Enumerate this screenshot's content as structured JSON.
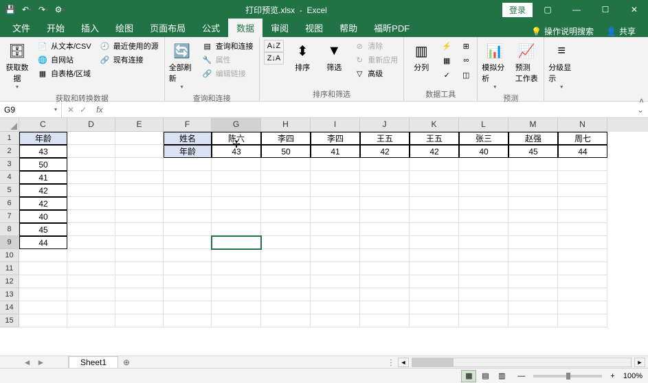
{
  "title": {
    "file": "打印预览.xlsx",
    "app": "Excel",
    "login": "登录"
  },
  "tabs": {
    "file": "文件",
    "home": "开始",
    "insert": "插入",
    "draw": "绘图",
    "layout": "页面布局",
    "formulas": "公式",
    "data": "数据",
    "review": "审阅",
    "view": "视图",
    "help": "帮助",
    "foxit": "福昕PDF",
    "tellme": "操作说明搜索",
    "share": "共享"
  },
  "ribbon": {
    "get_data": "获取数\n据",
    "from_csv": "从文本/CSV",
    "recent": "最近使用的源",
    "from_web": "自网站",
    "existing": "现有连接",
    "from_table": "自表格/区域",
    "group1_label": "获取和转换数据",
    "refresh_all": "全部刷新",
    "queries": "查询和连接",
    "properties": "属性",
    "edit_links": "编辑链接",
    "group2_label": "查询和连接",
    "sort": "排序",
    "filter": "筛选",
    "clear": "清除",
    "reapply": "重新应用",
    "advanced": "高级",
    "group3_label": "排序和筛选",
    "text_cols": "分列",
    "group4_label": "数据工具",
    "what_if": "模拟分析",
    "forecast": "预测\n工作表",
    "group5_label": "预测",
    "outline": "分级显示",
    "sort_az": "A→Z",
    "sort_za": "Z→A"
  },
  "formula_bar": {
    "name_box": "G9",
    "fx": "fx"
  },
  "grid": {
    "cols": [
      "C",
      "D",
      "E",
      "F",
      "G",
      "H",
      "I",
      "J",
      "K",
      "L",
      "M",
      "N"
    ],
    "rows": [
      1,
      2,
      3,
      4,
      5,
      6,
      7,
      8,
      9,
      10,
      11,
      12,
      13,
      14,
      15
    ],
    "c_header": "年龄",
    "c_values": [
      "43",
      "50",
      "41",
      "42",
      "42",
      "40",
      "45",
      "44"
    ],
    "f1": "姓名",
    "f2": "年龄",
    "names": [
      "陈六",
      "李四",
      "李四",
      "王五",
      "王五",
      "张三",
      "赵强",
      "周七"
    ],
    "ages": [
      "43",
      "50",
      "41",
      "42",
      "42",
      "40",
      "45",
      "44"
    ]
  },
  "chart_data": {
    "type": "table",
    "tables": [
      {
        "header": "年龄",
        "column": "C",
        "values": [
          43,
          50,
          41,
          42,
          42,
          40,
          45,
          44
        ]
      },
      {
        "headers_row": [
          "姓名",
          "陈六",
          "李四",
          "李四",
          "王五",
          "王五",
          "张三",
          "赵强",
          "周七"
        ],
        "values_row": [
          "年龄",
          43,
          50,
          41,
          42,
          42,
          40,
          45,
          44
        ],
        "columns": [
          "F",
          "G",
          "H",
          "I",
          "J",
          "K",
          "L",
          "M",
          "N"
        ]
      }
    ]
  },
  "sheet": {
    "name": "Sheet1"
  },
  "status": {
    "ready": "",
    "zoom": "100%"
  }
}
